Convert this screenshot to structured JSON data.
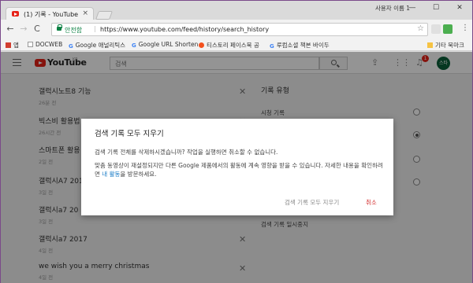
{
  "window": {
    "user_label": "사용자 이름 1",
    "minimize": "—",
    "maximize": "☐",
    "close": "✕"
  },
  "tab": {
    "title": "(1) 기록 - YouTube",
    "close": "×"
  },
  "toolbar": {
    "back": "←",
    "forward": "→",
    "reload": "C",
    "secure_label": "안전함",
    "url": "https://www.youtube.com/feed/history/search_history",
    "star": "☆",
    "menu": "⋮"
  },
  "bookmarks": [
    {
      "label": "앱",
      "color": "#d23f31"
    },
    {
      "label": "DOCWEB",
      "color": "#bdbdbd"
    },
    {
      "label": "Google 애널리틱스",
      "color": "#4285f4"
    },
    {
      "label": "Google URL Shorten",
      "color": "#4285f4"
    },
    {
      "label": "티스토리 페이스북 공",
      "color": "#f4511e"
    },
    {
      "label": "루컴소셜 책본 바이두",
      "color": "#4285f4"
    },
    {
      "label": "기타 북마크",
      "color": "#f6c343"
    }
  ],
  "youtube": {
    "logo_text": "YouTube",
    "logo_region": "KR",
    "search_placeholder": "검색",
    "notification_count": "1",
    "avatar_text": "스타"
  },
  "history": [
    {
      "query": "갤럭시노트8 기능",
      "time": "26분 전"
    },
    {
      "query": "빅스비 활용법",
      "time": "26시간 전"
    },
    {
      "query": "스마트폰 활용",
      "time": "2일 전"
    },
    {
      "query": "갤럭시A7 2017",
      "time": "3일 전"
    },
    {
      "query": "갤럭시a7 20",
      "time": "3일 전"
    },
    {
      "query": "갤럭시a7 2017",
      "time": "4일 전"
    },
    {
      "query": "we wish you a merry christmas",
      "time": "4일 전"
    }
  ],
  "sidebar": {
    "heading": "기록 유형",
    "option1": "시청 기록",
    "pause_link": "검색 기록 일시중지"
  },
  "dialog": {
    "title": "검색 기록 모두 지우기",
    "p1": "검색 기록 전체를 삭제하시겠습니까? 작업을 실행하면 취소할 수 없습니다.",
    "p2_before": "맞춤 동영상이 재설정되지만 다른 Google 제품에서의 활동에 계속 영향을 받을 수 있습니다. 자세한 내용을 확인하려면 ",
    "p2_link": "내 활동",
    "p2_after": "을 방문하세요.",
    "confirm_label": "검색 기록 모두 지우기",
    "cancel_label": "취소"
  }
}
